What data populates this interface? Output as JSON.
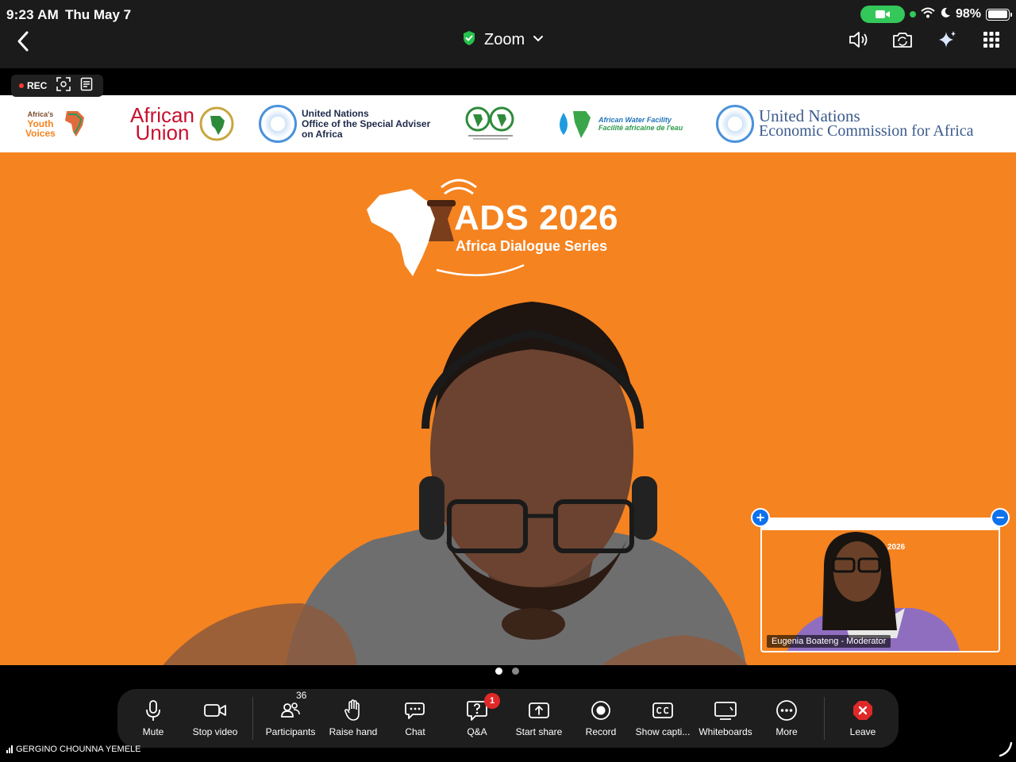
{
  "status_bar": {
    "time": "9:23 AM",
    "date": "Thu May 7",
    "battery": "98%",
    "battery_level": 0.98
  },
  "header": {
    "title": "Zoom"
  },
  "recording": {
    "label": "REC"
  },
  "content": {
    "logos": {
      "youth_1": "Africa's",
      "youth_2": "Youth",
      "youth_3": "Voices",
      "au_1": "African",
      "au_2": "Union",
      "osaa_1": "United Nations",
      "osaa_2": "Office of the Special Adviser",
      "osaa_3": "on Africa",
      "awf_1": "African Water Facility",
      "awf_2": "Facilité africaine de l'eau",
      "eca_1": "United Nations",
      "eca_2": "Economic Commission for Africa"
    },
    "ads_title": "ADS 2026",
    "ads_subtitle": "Africa Dialogue Series"
  },
  "pip": {
    "name": "Eugenia Boateng - Moderator",
    "ads_fragment": "2026"
  },
  "toolbar": {
    "mute": "Mute",
    "stop_video": "Stop video",
    "participants": "Participants",
    "participants_count": "36",
    "raise_hand": "Raise hand",
    "chat": "Chat",
    "qa": "Q&A",
    "qa_badge": "1",
    "start_share": "Start share",
    "record": "Record",
    "show_captions": "Show capti...",
    "whiteboards": "Whiteboards",
    "more": "More",
    "leave": "Leave"
  },
  "footer": {
    "active_speaker": "GERGINO CHOUNNA YEMELE"
  },
  "colors": {
    "accent_orange": "#f58320",
    "zoom_blue": "#0e72ed",
    "leave_red": "#e02828",
    "secure_green": "#34c759"
  },
  "icons": {
    "header": [
      "back-arrow-icon",
      "shield-check-icon",
      "chevron-down-icon",
      "speaker-icon",
      "camera-switch-icon",
      "sparkle-icon",
      "grid-icon"
    ],
    "toolbar": [
      "microphone-icon",
      "video-camera-icon",
      "participants-icon",
      "hand-icon",
      "chat-icon",
      "question-icon",
      "share-icon",
      "record-icon",
      "cc-icon",
      "whiteboard-icon",
      "more-icon",
      "leave-icon"
    ]
  }
}
